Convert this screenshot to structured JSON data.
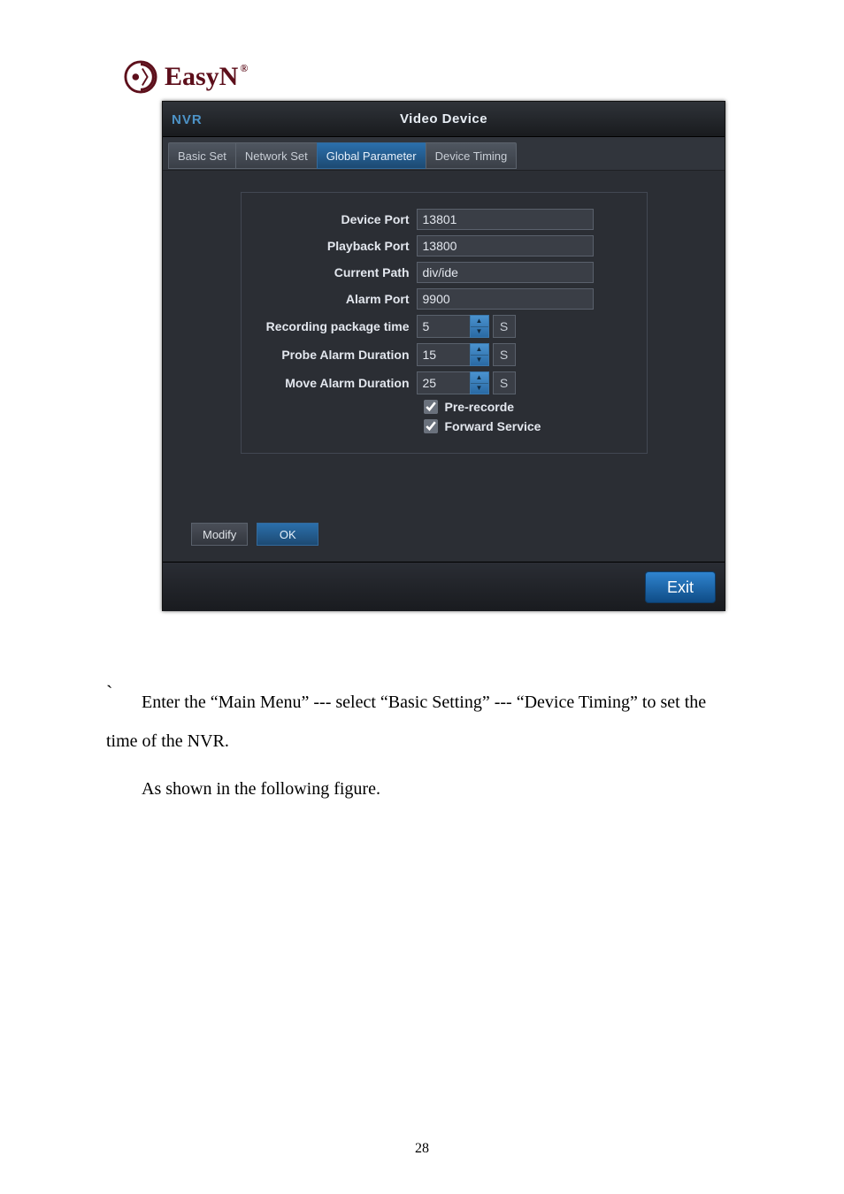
{
  "logo": {
    "brand": "EasyN",
    "reg": "®"
  },
  "window": {
    "left_label": "NVR",
    "title": "Video Device"
  },
  "tabs": [
    "Basic Set",
    "Network Set",
    "Global Parameter",
    "Device Timing"
  ],
  "form": {
    "device_port": {
      "label": "Device Port",
      "value": "13801"
    },
    "playback_port": {
      "label": "Playback Port",
      "value": "13800"
    },
    "current_path": {
      "label": "Current Path",
      "value": "div/ide"
    },
    "alarm_port": {
      "label": "Alarm Port",
      "value": "9900"
    },
    "recording_pkg": {
      "label": "Recording package time",
      "value": "5",
      "unit": "S"
    },
    "probe_alarm": {
      "label": "Probe Alarm Duration",
      "value": "15",
      "unit": "S"
    },
    "move_alarm": {
      "label": "Move Alarm Duration",
      "value": "25",
      "unit": "S"
    },
    "pre_recorde": {
      "label": "Pre-recorde",
      "checked": true
    },
    "forward_service": {
      "label": "Forward Service",
      "checked": true
    }
  },
  "actions": {
    "modify": "Modify",
    "ok": "OK",
    "exit": "Exit"
  },
  "body": {
    "backtick": "`",
    "p1": "Enter the “Main Menu” --- select “Basic Setting” --- “Device Timing” to set the time of the NVR.",
    "p2": "As shown in the following figure."
  },
  "page_number": "28"
}
